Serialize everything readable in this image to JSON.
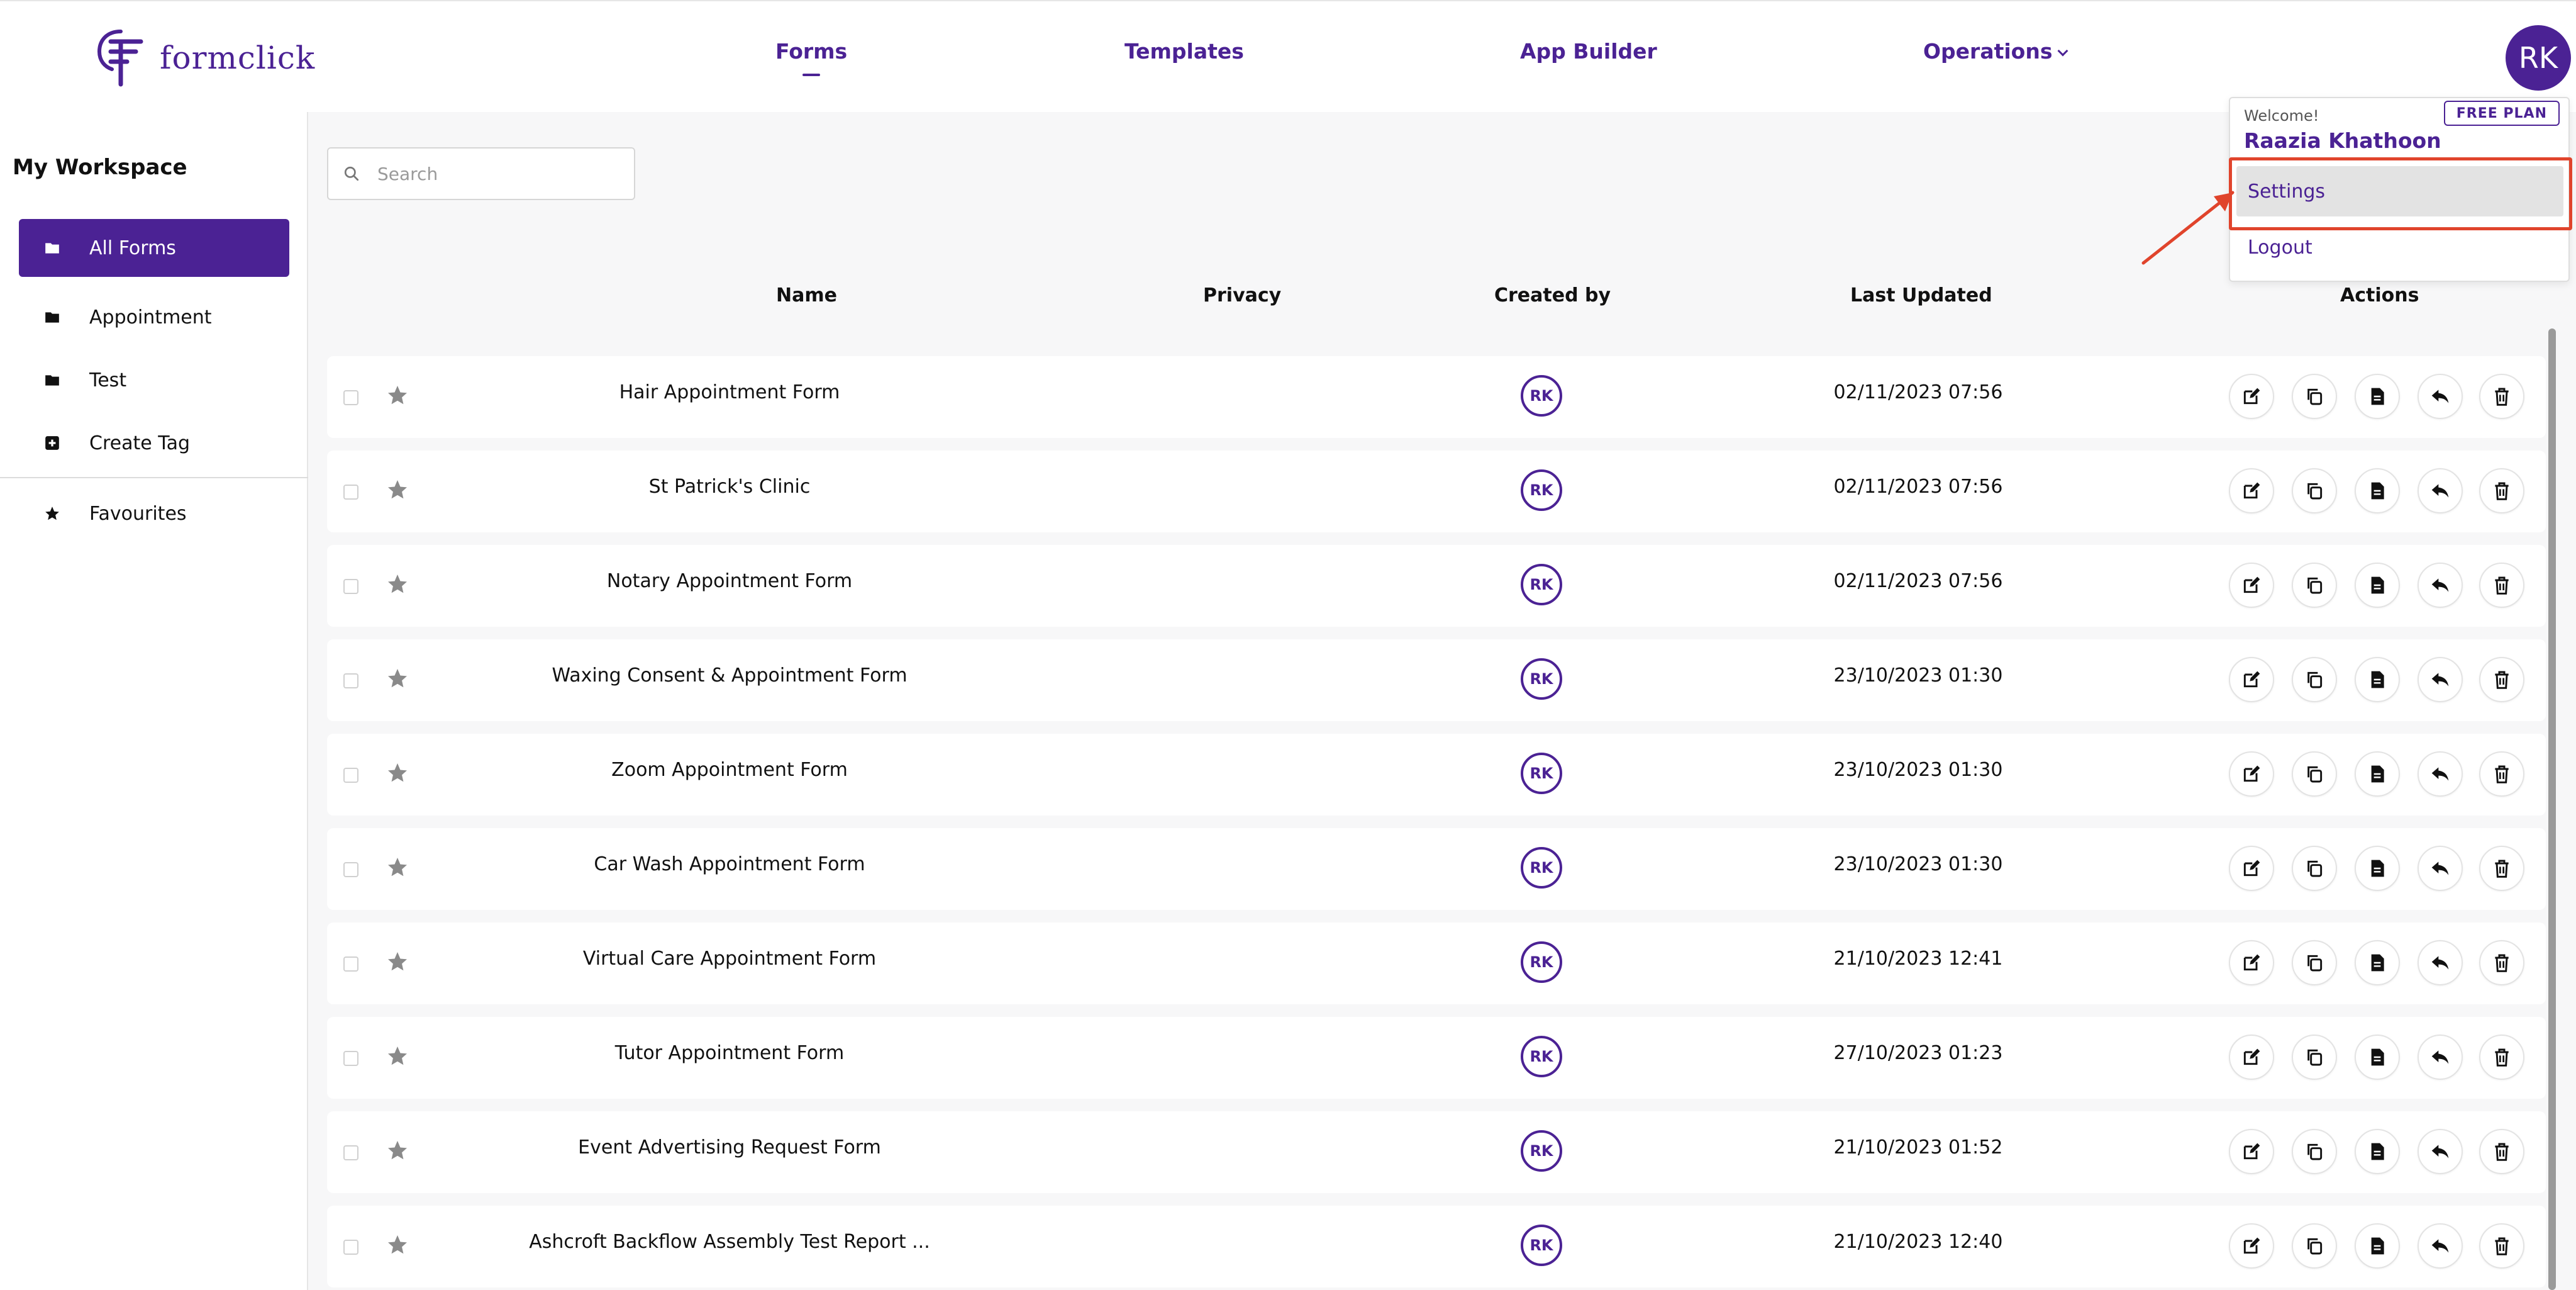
{
  "app": {
    "logo_text": "formclick"
  },
  "nav": {
    "items": [
      {
        "label": "Forms",
        "active": true
      },
      {
        "label": "Templates"
      },
      {
        "label": "App Builder"
      },
      {
        "label": "Operations",
        "has_dropdown": true
      }
    ],
    "avatar_initials": "RK"
  },
  "sidebar": {
    "title": "My Workspace",
    "items": [
      {
        "label": "All Forms",
        "icon": "folder-icon",
        "active": true
      },
      {
        "label": "Appointment",
        "icon": "folder-icon"
      },
      {
        "label": "Test",
        "icon": "folder-icon"
      },
      {
        "label": "Create Tag",
        "icon": "plus-square-icon"
      },
      {
        "label": "Favourites",
        "icon": "star-icon"
      }
    ]
  },
  "search": {
    "placeholder": "Search"
  },
  "table": {
    "headers": {
      "name": "Name",
      "privacy": "Privacy",
      "created_by": "Created by",
      "last_updated": "Last Updated",
      "actions": "Actions"
    },
    "rows": [
      {
        "name": "Hair Appointment Form",
        "created_by": "RK",
        "last_updated": "02/11/2023 07:56"
      },
      {
        "name": "St Patrick's Clinic",
        "created_by": "RK",
        "last_updated": "02/11/2023 07:56"
      },
      {
        "name": "Notary Appointment Form",
        "created_by": "RK",
        "last_updated": "02/11/2023 07:56"
      },
      {
        "name": "Waxing Consent & Appointment Form",
        "created_by": "RK",
        "last_updated": "23/10/2023 01:30"
      },
      {
        "name": "Zoom Appointment Form",
        "created_by": "RK",
        "last_updated": "23/10/2023 01:30"
      },
      {
        "name": "Car Wash Appointment Form",
        "created_by": "RK",
        "last_updated": "23/10/2023 01:30"
      },
      {
        "name": "Virtual Care Appointment Form",
        "created_by": "RK",
        "last_updated": "21/10/2023 12:41"
      },
      {
        "name": "Tutor Appointment Form",
        "created_by": "RK",
        "last_updated": "27/10/2023 01:23"
      },
      {
        "name": "Event Advertising Request Form",
        "created_by": "RK",
        "last_updated": "21/10/2023 01:52"
      },
      {
        "name": "Ashcroft Backflow Assembly Test Report ...",
        "created_by": "RK",
        "last_updated": "21/10/2023 12:40"
      }
    ],
    "row_actions": [
      "edit-icon",
      "duplicate-icon",
      "document-icon",
      "reply-icon",
      "trash-icon"
    ]
  },
  "user_menu": {
    "welcome": "Welcome!",
    "user_name": "Raazia Khathoon",
    "plan_badge": "FREE PLAN",
    "items": [
      {
        "label": "Settings",
        "highlighted": true
      },
      {
        "label": "Logout"
      }
    ]
  },
  "colors": {
    "brand": "#4b2294",
    "annotation": "#e0442c"
  }
}
